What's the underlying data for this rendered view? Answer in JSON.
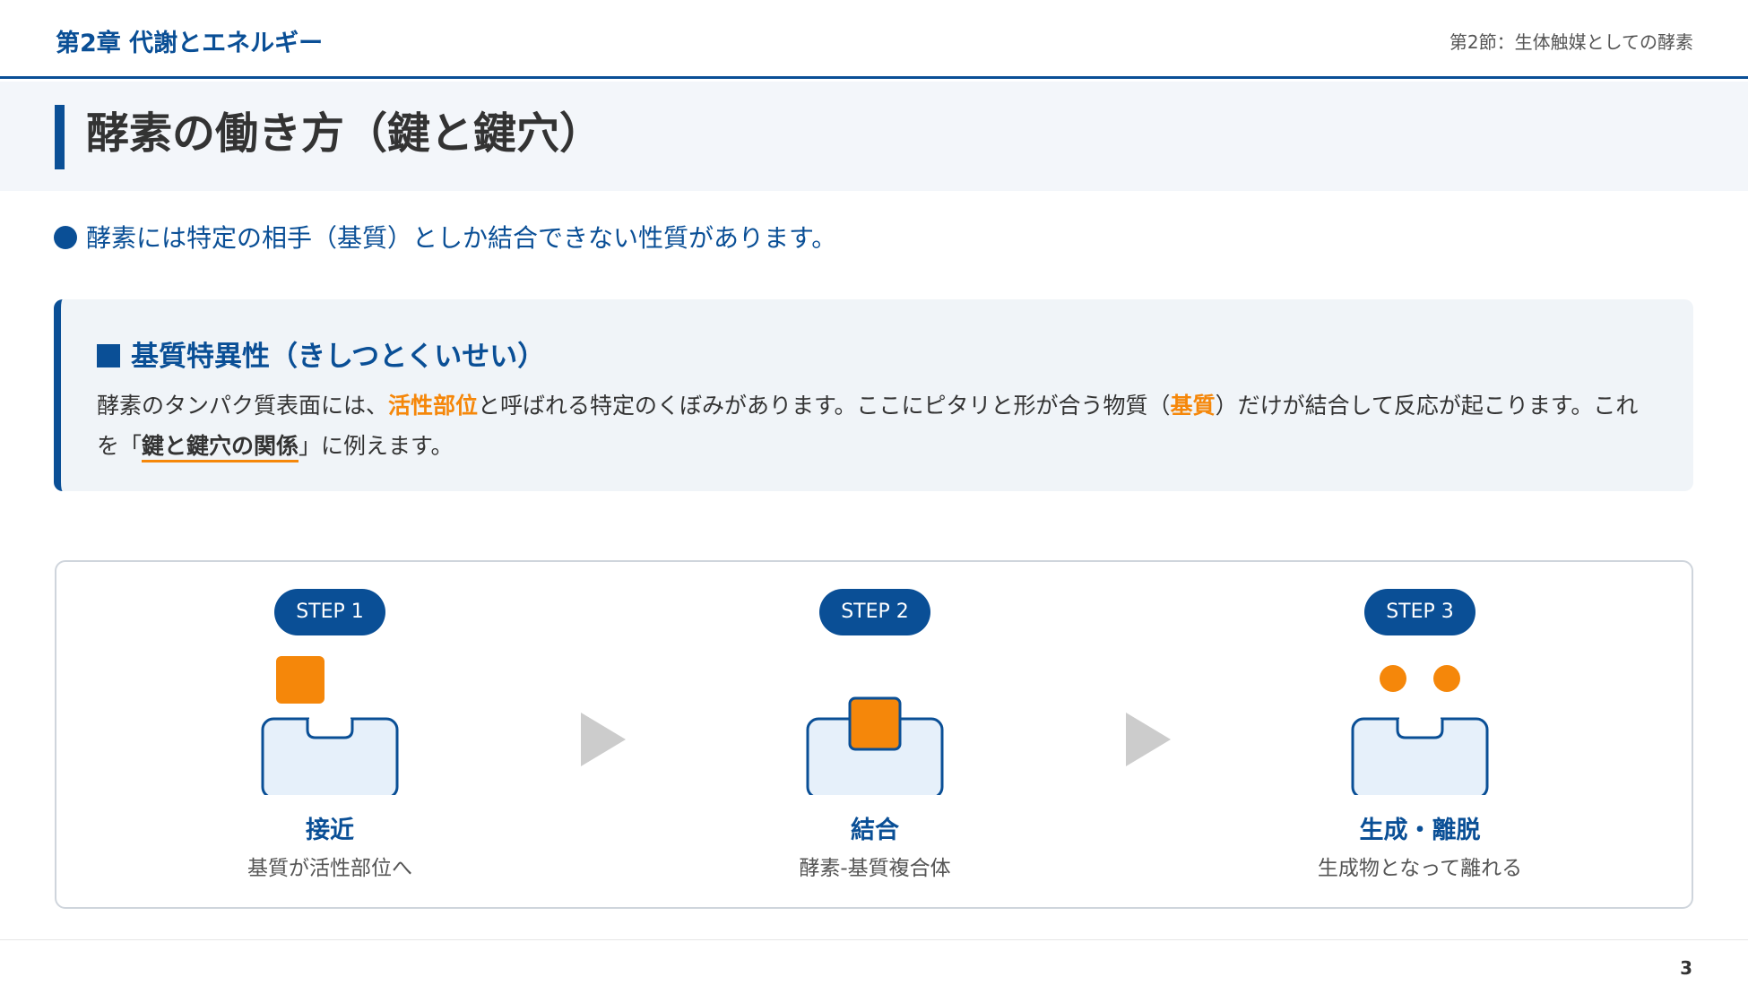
{
  "header": {
    "chapter": "第2章 代謝とエネルギー",
    "section": "第2節：生体触媒としての酵素"
  },
  "title": "酵素の働き方（鍵と鍵穴）",
  "lead": "酵素には特定の相手（基質）としか結合できない性質があります。",
  "info": {
    "heading": "基質特異性（きしつとくいせい）",
    "text_1": "酵素のタンパク質表面には、",
    "highlight_1": "活性部位",
    "text_2": "と呼ばれる特定のくぼみがあります。ここにピタリと形が合う物質（",
    "highlight_2": "基質",
    "text_3": "）だけが結合して反応が起こります。これを「",
    "key_phrase": "鍵と鍵穴の関係",
    "text_4": "」に例えます。"
  },
  "steps": [
    {
      "badge": "STEP 1",
      "label": "接近",
      "description": "基質が活性部位へ"
    },
    {
      "badge": "STEP 2",
      "label": "結合",
      "description": "酵素-基質複合体"
    },
    {
      "badge": "STEP 3",
      "label": "生成・離脱",
      "description": "生成物となって離れる"
    }
  ],
  "icons": {
    "bullet": "filled-circle-icon",
    "heading_marker": "filled-square-icon",
    "arrow": "play-triangle-icon"
  },
  "colors": {
    "primary": "#0a4f96",
    "accent": "#f5870a",
    "enzyme_fill": "#e6f0fa",
    "box_background": "#f0f4f8",
    "arrow": "#cccccc"
  },
  "page_number": "3"
}
